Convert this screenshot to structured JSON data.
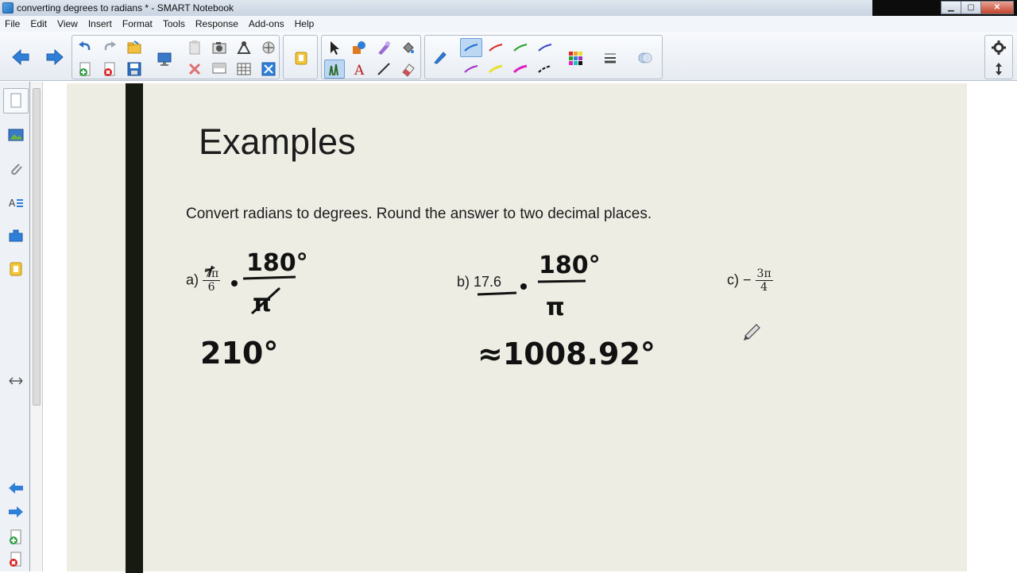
{
  "window": {
    "title": "converting degrees to radians * - SMART Notebook",
    "controls": [
      "minimize",
      "maximize",
      "close"
    ]
  },
  "menu": [
    "File",
    "Edit",
    "View",
    "Insert",
    "Format",
    "Tools",
    "Response",
    "Add-ons",
    "Help"
  ],
  "toolbar": {
    "icons": [
      "back-arrow-icon",
      "forward-arrow-icon",
      "undo-icon",
      "redo-icon",
      "open-icon",
      "add-page-icon",
      "delete-page-icon",
      "save-icon",
      "display-icon",
      "paste-icon",
      "clear-icon",
      "screen-shade-icon",
      "table-icon",
      "full-screen-icon",
      "capture-icon",
      "document-camera-icon",
      "pan-icon",
      "select-icon",
      "pens-icon",
      "text-icon",
      "lines-icon",
      "eraser-icon",
      "shapes-icon",
      "fill-icon",
      "properties-icon",
      "settings-icon"
    ],
    "pen_colors": [
      "#1e6fd0",
      "#e02828",
      "#28a028",
      "#3848c8",
      "#a030c0",
      "#e8e030",
      "#e020c0",
      "#111111"
    ],
    "accent": "#2f7fd8"
  },
  "sidebar": {
    "icons": [
      "page-sorter-icon",
      "gallery-icon",
      "attachments-icon",
      "properties-icon",
      "add-ons-icon",
      "response-icon"
    ],
    "bottom_icons": [
      "previous-page-icon",
      "next-page-icon",
      "add-page-icon",
      "delete-page-icon"
    ]
  },
  "slide": {
    "heading": "Examples",
    "instruction": "Convert radians to degrees. Round the answer to two decimal places.",
    "problem_a": {
      "label": "a)",
      "num": "7π",
      "den": "6",
      "work_fraction": {
        "num": "180°",
        "den": "π"
      },
      "answer": "210°"
    },
    "problem_b": {
      "label": "b)",
      "value": "17.6",
      "work_fraction": {
        "num": "180°",
        "den": "π"
      },
      "answer": "≈1008.92°"
    },
    "problem_c": {
      "label": "c)",
      "sign": "−",
      "num": "3π",
      "den": "4"
    }
  }
}
